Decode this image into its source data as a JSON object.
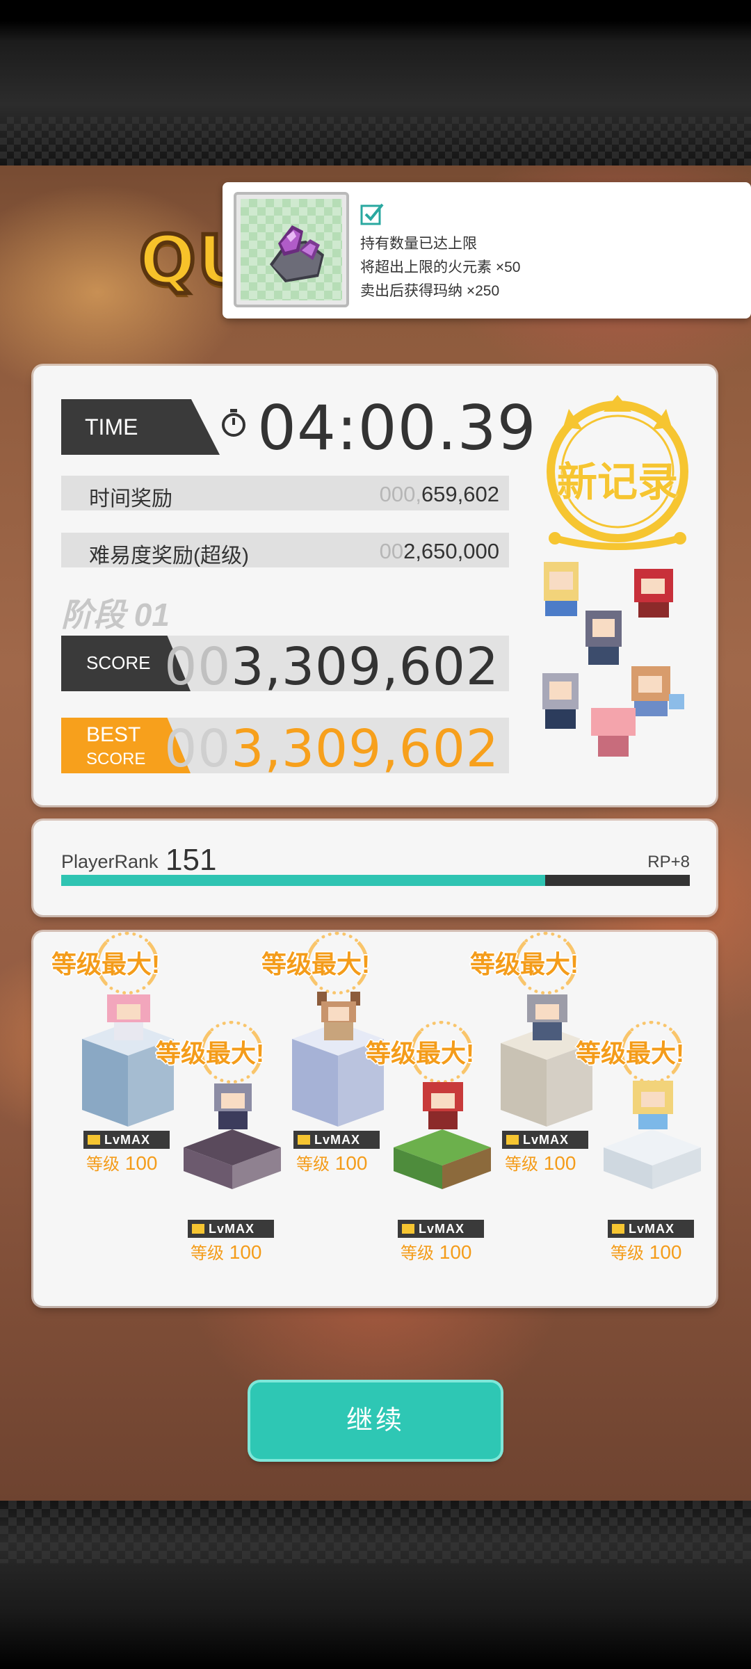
{
  "header": {
    "quest_title_partial": "QU"
  },
  "notice": {
    "item_icon": "fire-element-crystal-icon",
    "check_icon": "checkbox-checked-icon",
    "lines": [
      "持有数量已达上限",
      "将超出上限的火元素 ×50",
      "卖出后获得玛纳 ×250"
    ]
  },
  "results": {
    "time_label": "TIME",
    "time_value": "04:00.39",
    "time_bonus": {
      "label": "时间奖励",
      "value_dim": "000,",
      "value": "659,602"
    },
    "difficulty_bonus": {
      "label": "难易度奖励(超级)",
      "value_dim": "00",
      "value": "2,650,000"
    },
    "stage_label": "阶段 01",
    "score": {
      "label": "SCORE",
      "value_dim": "00",
      "value": "3,309,602"
    },
    "best": {
      "label1": "BEST",
      "label2": "SCORE",
      "value_dim": "00",
      "value": "3,309,602"
    },
    "new_record": "新记录"
  },
  "rank": {
    "label": "PlayerRank",
    "value": "151",
    "rp": "RP+8",
    "progress_fraction": 0.77
  },
  "units": [
    {
      "badge": "等级最大!",
      "lvmax": "LvMAX",
      "level_label": "等级",
      "level": "100",
      "pedestal": "#8aa8c4"
    },
    {
      "badge": "等级最大!",
      "lvmax": "LvMAX",
      "level_label": "等级",
      "level": "100",
      "pedestal": "#6c5a6e"
    },
    {
      "badge": "等级最大!",
      "lvmax": "LvMAX",
      "level_label": "等级",
      "level": "100",
      "pedestal": "#a6b2d6"
    },
    {
      "badge": "等级最大!",
      "lvmax": "LvMAX",
      "level_label": "等级",
      "level": "100",
      "pedestal": "#4e8c3c"
    },
    {
      "badge": "等级最大!",
      "lvmax": "LvMAX",
      "level_label": "等级",
      "level": "100",
      "pedestal": "#c9c2b4"
    },
    {
      "badge": "等级最大!",
      "lvmax": "LvMAX",
      "level_label": "等级",
      "level": "100",
      "pedestal": "#cfd8e0"
    }
  ],
  "continue_button": "继续",
  "colors": {
    "accent_teal": "#2fc4b2",
    "best_orange": "#f7a01c",
    "record_gold": "#f6c531"
  }
}
